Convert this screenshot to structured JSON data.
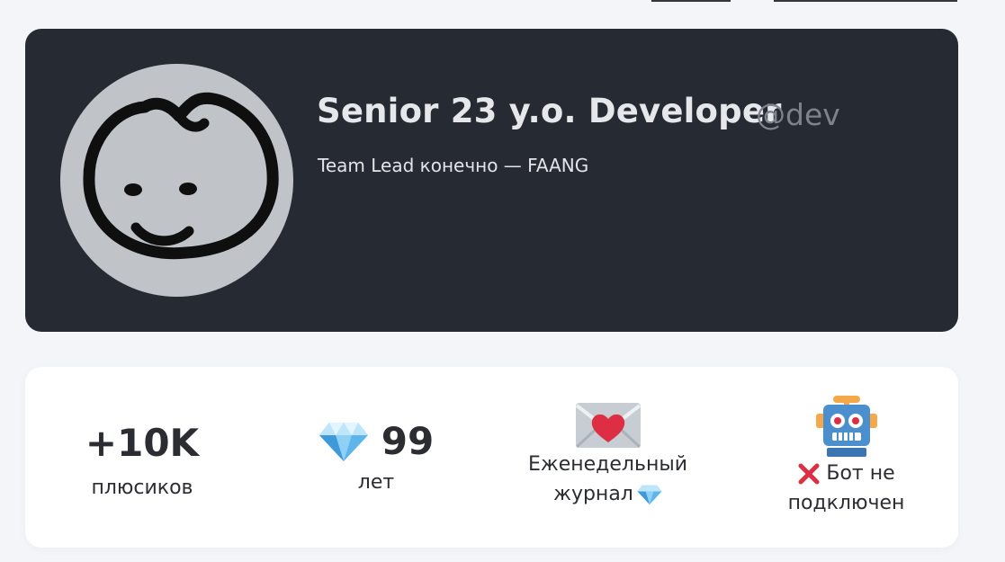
{
  "profile": {
    "name": "Senior 23 y.o. Developer",
    "handle": "@dev",
    "tagline": "Team Lead конечно — FAANG",
    "avatar_icon": "smiley-doodle-icon"
  },
  "stats": {
    "plus": {
      "value": "+10K",
      "label": "плюсиков"
    },
    "years": {
      "icon": "gem-icon",
      "value": "99",
      "label": "лет"
    },
    "journal": {
      "icon": "love-letter-icon",
      "label_line1": "Еженедельный",
      "label_line2": "журнал",
      "suffix_icon": "gem-icon"
    },
    "bot": {
      "icon": "robot-icon",
      "status_icon": "cross-mark-icon",
      "label_line1": "Бот не",
      "label_line2": "подключен"
    }
  },
  "colors": {
    "page_bg": "#f4f5f8",
    "profile_card_bg": "#262a33",
    "avatar_bg": "#c0c3c7",
    "handle": "#7e828b",
    "stats_card_bg": "#ffffff",
    "gem": "#5fb4ea",
    "heart": "#dd2e44",
    "robot": "#4c8fcf",
    "cross": "#dd2e44"
  }
}
